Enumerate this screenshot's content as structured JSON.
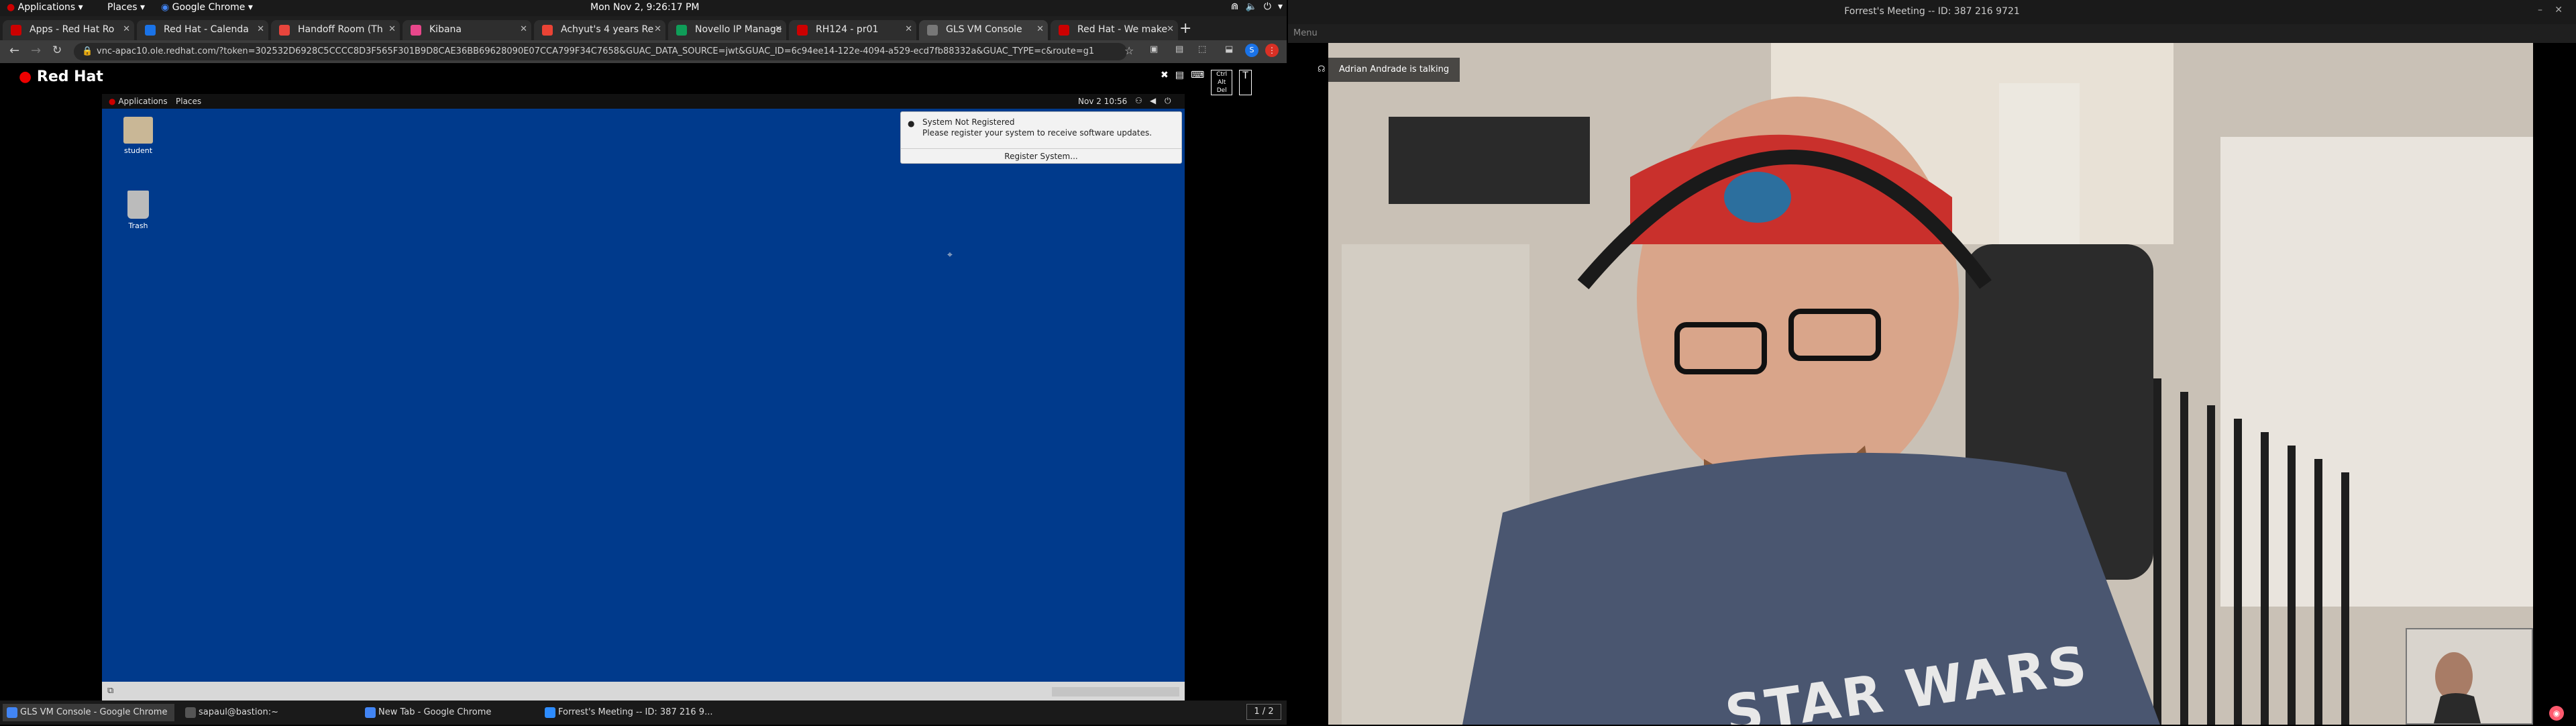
{
  "top_panel": {
    "applications": "Applications",
    "places": "Places",
    "chrome": "Google Chrome",
    "clock": "Mon Nov  2,  9:26:17 PM"
  },
  "chrome": {
    "tabs": [
      {
        "label": "Apps - Red Hat Ro",
        "fav_color": "#cc0000"
      },
      {
        "label": "Red Hat - Calenda",
        "fav_color": "#1a73e8"
      },
      {
        "label": "Handoff Room (Th",
        "fav_color": "#e8453c"
      },
      {
        "label": "Kibana",
        "fav_color": "#e8478b"
      },
      {
        "label": "Achyut's 4 years Re",
        "fav_color": "#ea4335"
      },
      {
        "label": "Novello IP Manage",
        "fav_color": "#0f9d58"
      },
      {
        "label": "RH124 - pr01",
        "fav_color": "#cc0000"
      },
      {
        "label": "GLS VM Console",
        "fav_color": "#777777"
      },
      {
        "label": "Red Hat - We make",
        "fav_color": "#cc0000"
      }
    ],
    "new_tab": "+",
    "address": "vnc-apac10.ole.redhat.com/?token=302532D6928C5CCCC8D3F565F301B9D8CAE36BB69628090E07CCA799F34C7658&GUAC_DATA_SOURCE=jwt&GUAC_ID=6c94ee14-122e-4094-a529-ecd7fb88332a&GUAC_TYPE=c&route=g1"
  },
  "rh_page": {
    "logo_text": "Red Hat",
    "tools": [
      "✖",
      "▤",
      "⌨",
      "Ctrl Alt Del",
      "T"
    ]
  },
  "vm_desktop": {
    "applications": "Applications",
    "places": "Places",
    "date": "Nov 2  10:56",
    "icons": [
      {
        "label": "student"
      },
      {
        "label": "Trash"
      }
    ],
    "notification": {
      "title": "System Not Registered",
      "body": "Please register your system to receive software updates.",
      "button": "Register System..."
    }
  },
  "taskbar": {
    "items": [
      {
        "label": "GLS VM Console - Google Chrome",
        "color": "#4285f4"
      },
      {
        "label": "sapaul@bastion:~",
        "color": "#555555"
      },
      {
        "label": "New Tab - Google Chrome",
        "color": "#4285f4"
      },
      {
        "label": "Forrest's Meeting -- ID: 387 216 9...",
        "color": "#2d8cff"
      }
    ],
    "pager": "1 / 2"
  },
  "zoom": {
    "title": "Forrest's Meeting -- ID: 387 216 9721",
    "menu": "Menu",
    "talking": "Adrian Andrade is talking",
    "shirt_text": "STAR WARS"
  }
}
